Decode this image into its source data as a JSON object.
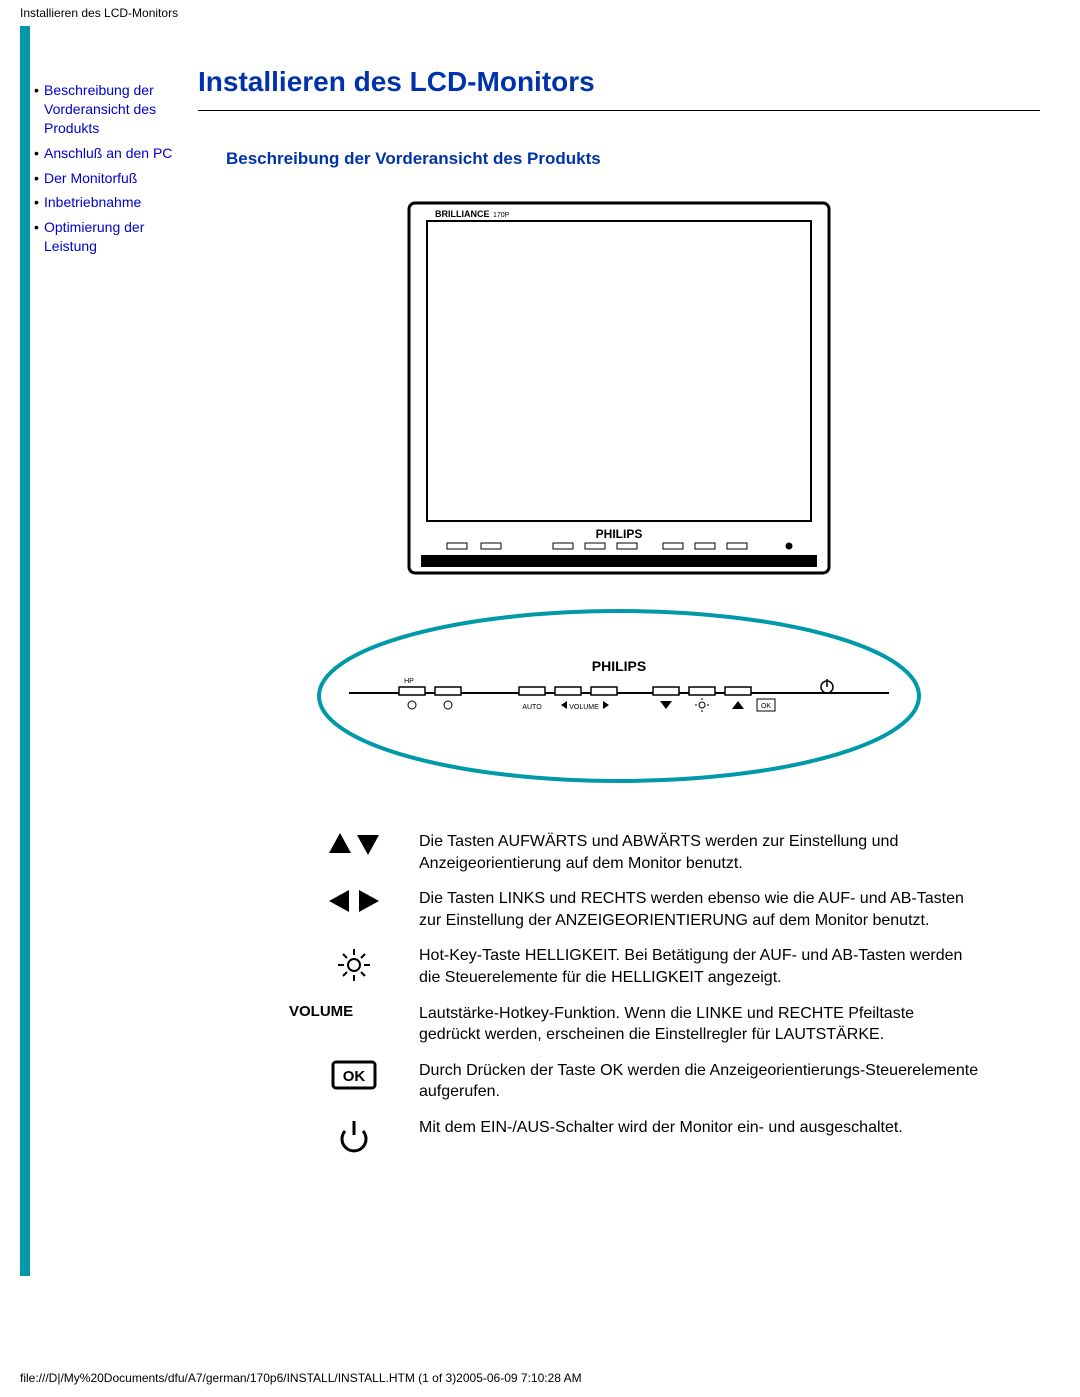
{
  "header_title": "Installieren des LCD-Monitors",
  "sidebar": {
    "items": [
      {
        "label": "Beschreibung der Vorderansicht des Produkts"
      },
      {
        "label": "Anschluß an den PC"
      },
      {
        "label": "Der Monitorfuß"
      },
      {
        "label": "Inbetriebnahme"
      },
      {
        "label": "Optimierung der Leistung"
      }
    ]
  },
  "page": {
    "title": "Installieren des LCD-Monitors",
    "section_heading": "Beschreibung der Vorderansicht des Produkts"
  },
  "monitor": {
    "bezel_label": "BRILLIANCE 170P",
    "brand": "PHILIPS",
    "panel_labels": [
      "AUTO",
      "VOLUME"
    ]
  },
  "legend": {
    "rows": [
      {
        "icon": "up-down",
        "text": "Die Tasten AUFWÄRTS und ABWÄRTS werden zur Einstellung und Anzeigeorientierung auf dem Monitor benutzt."
      },
      {
        "icon": "left-right",
        "text": "Die Tasten LINKS und RECHTS werden ebenso wie die AUF- und AB-Tasten zur Einstellung der ANZEIGEORIENTIERUNG auf dem Monitor benutzt."
      },
      {
        "icon": "brightness",
        "text": "Hot-Key-Taste HELLIGKEIT. Bei Betätigung der AUF- und AB-Tasten werden die Steuerelemente für die HELLIGKEIT angezeigt."
      },
      {
        "icon": "volume",
        "label": "VOLUME",
        "text": "Lautstärke-Hotkey-Funktion. Wenn die LINKE und RECHTE Pfeiltaste gedrückt werden, erscheinen die Einstellregler für LAUTSTÄRKE."
      },
      {
        "icon": "ok",
        "text": "Durch Drücken der Taste OK werden die Anzeigeorientierungs-Steuerelemente aufgerufen."
      },
      {
        "icon": "power",
        "text": "Mit dem EIN-/AUS-Schalter wird der Monitor ein- und ausgeschaltet."
      }
    ]
  },
  "footer": "file:///D|/My%20Documents/dfu/A7/german/170p6/INSTALL/INSTALL.HTM (1 of 3)2005-06-09 7:10:28 AM"
}
